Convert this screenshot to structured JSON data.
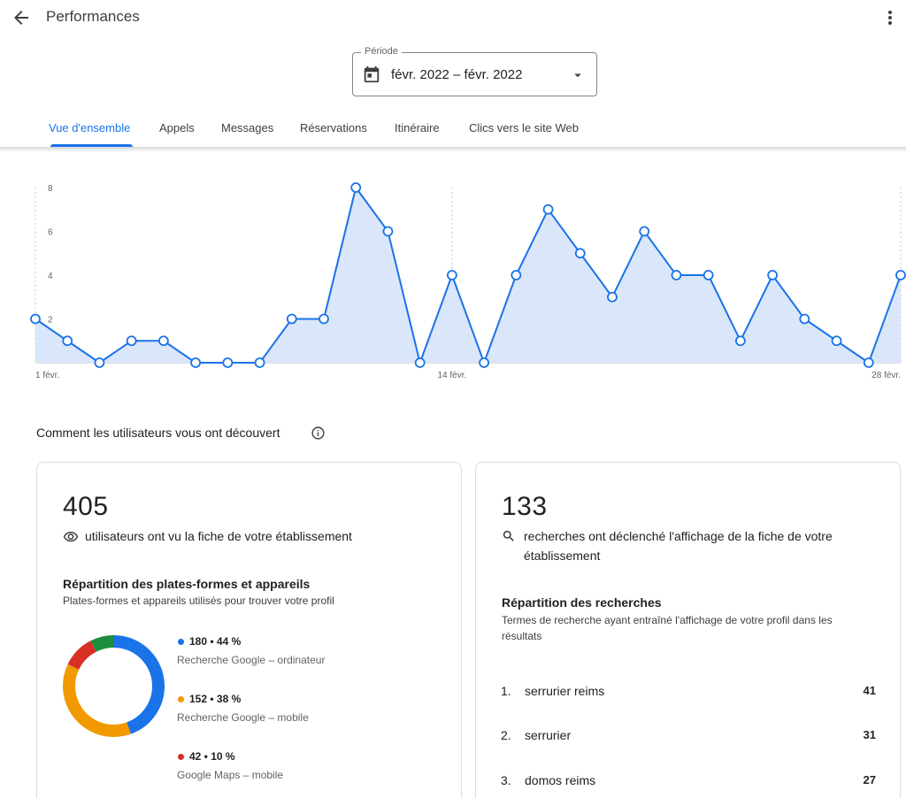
{
  "header": {
    "title": "Performances",
    "back_icon": "arrow-back-icon",
    "more_icon": "more-vert-icon"
  },
  "period": {
    "legend": "Période",
    "value": "févr. 2022 – févr. 2022",
    "icon": "calendar-icon",
    "dropdown_icon": "caret-down-icon"
  },
  "tabs": [
    {
      "label": "Vue d'ensemble",
      "active": true
    },
    {
      "label": "Appels",
      "active": false
    },
    {
      "label": "Messages",
      "active": false
    },
    {
      "label": "Réservations",
      "active": false
    },
    {
      "label": "Itinéraire",
      "active": false
    },
    {
      "label": "Clics vers le site Web",
      "active": false
    }
  ],
  "chart_data": {
    "type": "area",
    "x": [
      1,
      2,
      3,
      4,
      5,
      6,
      7,
      8,
      9,
      10,
      11,
      12,
      13,
      14,
      15,
      16,
      17,
      18,
      19,
      20,
      21,
      22,
      23,
      24,
      25,
      26,
      27,
      28
    ],
    "values": [
      2,
      1,
      0,
      1,
      1,
      0,
      0,
      0,
      2,
      2,
      8,
      6,
      0,
      4,
      0,
      4,
      7,
      5,
      3,
      6,
      4,
      4,
      1,
      4,
      2,
      1,
      0,
      4
    ],
    "x_tick_labels": [
      {
        "day": 1,
        "label": "1 févr."
      },
      {
        "day": 14,
        "label": "14 févr."
      },
      {
        "day": 28,
        "label": "28 févr."
      }
    ],
    "y_ticks": [
      2,
      4,
      6,
      8
    ],
    "ylim": [
      0,
      8
    ],
    "color": "#1a73e8",
    "fill": "#dae6f9"
  },
  "discovery": {
    "title": "Comment les utilisateurs vous ont découvert",
    "info_icon": "info-icon"
  },
  "views_card": {
    "number": "405",
    "icon": "eye-icon",
    "description": "utilisateurs ont vu la fiche de votre établissement",
    "breakdown_title": "Répartition des plates-formes et appareils",
    "breakdown_desc": "Plates-formes et appareils utilisés pour trouver votre profil",
    "donut": [
      {
        "value": 180,
        "percent": 44,
        "color": "#1a73e8"
      },
      {
        "value": 152,
        "percent": 38,
        "color": "#f29900"
      },
      {
        "value": 42,
        "percent": 10,
        "color": "#d93025"
      },
      {
        "value": 31,
        "percent": 8,
        "color": "#1e8e3e"
      }
    ],
    "legend": [
      {
        "value": "180 • 44 %",
        "label": "Recherche Google – ordinateur",
        "color": "#1a73e8"
      },
      {
        "value": "152 • 38 %",
        "label": "Recherche Google – mobile",
        "color": "#f29900"
      },
      {
        "value": "42 • 10 %",
        "label": "Google Maps – mobile",
        "color": "#d93025"
      }
    ]
  },
  "search_card": {
    "number": "133",
    "icon": "search-icon",
    "description_line1": "recherches ont déclenché l'affichage de la fiche de votre",
    "description_line2": "établissement",
    "breakdown_title": "Répartition des recherches",
    "breakdown_desc_line1": "Termes de recherche ayant entraîné l'affichage de votre profil dans les",
    "breakdown_desc_line2": "résultats",
    "terms": [
      {
        "rank": "1.",
        "term": "serrurier reims",
        "count": "41"
      },
      {
        "rank": "2.",
        "term": "serrurier",
        "count": "31"
      },
      {
        "rank": "3.",
        "term": "domos reims",
        "count": "27"
      }
    ]
  }
}
